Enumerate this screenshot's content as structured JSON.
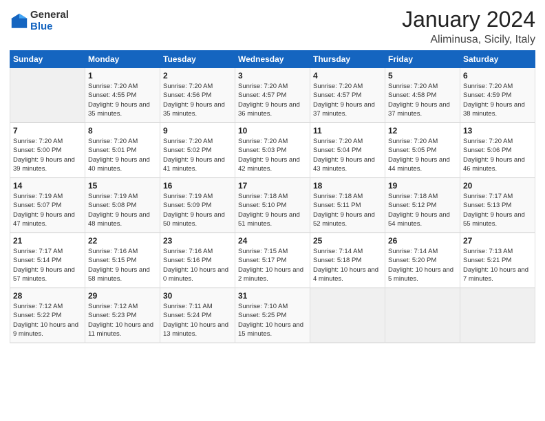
{
  "header": {
    "logo_general": "General",
    "logo_blue": "Blue",
    "title": "January 2024",
    "location": "Aliminusa, Sicily, Italy"
  },
  "weekdays": [
    "Sunday",
    "Monday",
    "Tuesday",
    "Wednesday",
    "Thursday",
    "Friday",
    "Saturday"
  ],
  "weeks": [
    [
      {
        "day": "",
        "sunrise": "",
        "sunset": "",
        "daylight": ""
      },
      {
        "day": "1",
        "sunrise": "Sunrise: 7:20 AM",
        "sunset": "Sunset: 4:55 PM",
        "daylight": "Daylight: 9 hours and 35 minutes."
      },
      {
        "day": "2",
        "sunrise": "Sunrise: 7:20 AM",
        "sunset": "Sunset: 4:56 PM",
        "daylight": "Daylight: 9 hours and 35 minutes."
      },
      {
        "day": "3",
        "sunrise": "Sunrise: 7:20 AM",
        "sunset": "Sunset: 4:57 PM",
        "daylight": "Daylight: 9 hours and 36 minutes."
      },
      {
        "day": "4",
        "sunrise": "Sunrise: 7:20 AM",
        "sunset": "Sunset: 4:57 PM",
        "daylight": "Daylight: 9 hours and 37 minutes."
      },
      {
        "day": "5",
        "sunrise": "Sunrise: 7:20 AM",
        "sunset": "Sunset: 4:58 PM",
        "daylight": "Daylight: 9 hours and 37 minutes."
      },
      {
        "day": "6",
        "sunrise": "Sunrise: 7:20 AM",
        "sunset": "Sunset: 4:59 PM",
        "daylight": "Daylight: 9 hours and 38 minutes."
      }
    ],
    [
      {
        "day": "7",
        "sunrise": "Sunrise: 7:20 AM",
        "sunset": "Sunset: 5:00 PM",
        "daylight": "Daylight: 9 hours and 39 minutes."
      },
      {
        "day": "8",
        "sunrise": "Sunrise: 7:20 AM",
        "sunset": "Sunset: 5:01 PM",
        "daylight": "Daylight: 9 hours and 40 minutes."
      },
      {
        "day": "9",
        "sunrise": "Sunrise: 7:20 AM",
        "sunset": "Sunset: 5:02 PM",
        "daylight": "Daylight: 9 hours and 41 minutes."
      },
      {
        "day": "10",
        "sunrise": "Sunrise: 7:20 AM",
        "sunset": "Sunset: 5:03 PM",
        "daylight": "Daylight: 9 hours and 42 minutes."
      },
      {
        "day": "11",
        "sunrise": "Sunrise: 7:20 AM",
        "sunset": "Sunset: 5:04 PM",
        "daylight": "Daylight: 9 hours and 43 minutes."
      },
      {
        "day": "12",
        "sunrise": "Sunrise: 7:20 AM",
        "sunset": "Sunset: 5:05 PM",
        "daylight": "Daylight: 9 hours and 44 minutes."
      },
      {
        "day": "13",
        "sunrise": "Sunrise: 7:20 AM",
        "sunset": "Sunset: 5:06 PM",
        "daylight": "Daylight: 9 hours and 46 minutes."
      }
    ],
    [
      {
        "day": "14",
        "sunrise": "Sunrise: 7:19 AM",
        "sunset": "Sunset: 5:07 PM",
        "daylight": "Daylight: 9 hours and 47 minutes."
      },
      {
        "day": "15",
        "sunrise": "Sunrise: 7:19 AM",
        "sunset": "Sunset: 5:08 PM",
        "daylight": "Daylight: 9 hours and 48 minutes."
      },
      {
        "day": "16",
        "sunrise": "Sunrise: 7:19 AM",
        "sunset": "Sunset: 5:09 PM",
        "daylight": "Daylight: 9 hours and 50 minutes."
      },
      {
        "day": "17",
        "sunrise": "Sunrise: 7:18 AM",
        "sunset": "Sunset: 5:10 PM",
        "daylight": "Daylight: 9 hours and 51 minutes."
      },
      {
        "day": "18",
        "sunrise": "Sunrise: 7:18 AM",
        "sunset": "Sunset: 5:11 PM",
        "daylight": "Daylight: 9 hours and 52 minutes."
      },
      {
        "day": "19",
        "sunrise": "Sunrise: 7:18 AM",
        "sunset": "Sunset: 5:12 PM",
        "daylight": "Daylight: 9 hours and 54 minutes."
      },
      {
        "day": "20",
        "sunrise": "Sunrise: 7:17 AM",
        "sunset": "Sunset: 5:13 PM",
        "daylight": "Daylight: 9 hours and 55 minutes."
      }
    ],
    [
      {
        "day": "21",
        "sunrise": "Sunrise: 7:17 AM",
        "sunset": "Sunset: 5:14 PM",
        "daylight": "Daylight: 9 hours and 57 minutes."
      },
      {
        "day": "22",
        "sunrise": "Sunrise: 7:16 AM",
        "sunset": "Sunset: 5:15 PM",
        "daylight": "Daylight: 9 hours and 58 minutes."
      },
      {
        "day": "23",
        "sunrise": "Sunrise: 7:16 AM",
        "sunset": "Sunset: 5:16 PM",
        "daylight": "Daylight: 10 hours and 0 minutes."
      },
      {
        "day": "24",
        "sunrise": "Sunrise: 7:15 AM",
        "sunset": "Sunset: 5:17 PM",
        "daylight": "Daylight: 10 hours and 2 minutes."
      },
      {
        "day": "25",
        "sunrise": "Sunrise: 7:14 AM",
        "sunset": "Sunset: 5:18 PM",
        "daylight": "Daylight: 10 hours and 4 minutes."
      },
      {
        "day": "26",
        "sunrise": "Sunrise: 7:14 AM",
        "sunset": "Sunset: 5:20 PM",
        "daylight": "Daylight: 10 hours and 5 minutes."
      },
      {
        "day": "27",
        "sunrise": "Sunrise: 7:13 AM",
        "sunset": "Sunset: 5:21 PM",
        "daylight": "Daylight: 10 hours and 7 minutes."
      }
    ],
    [
      {
        "day": "28",
        "sunrise": "Sunrise: 7:12 AM",
        "sunset": "Sunset: 5:22 PM",
        "daylight": "Daylight: 10 hours and 9 minutes."
      },
      {
        "day": "29",
        "sunrise": "Sunrise: 7:12 AM",
        "sunset": "Sunset: 5:23 PM",
        "daylight": "Daylight: 10 hours and 11 minutes."
      },
      {
        "day": "30",
        "sunrise": "Sunrise: 7:11 AM",
        "sunset": "Sunset: 5:24 PM",
        "daylight": "Daylight: 10 hours and 13 minutes."
      },
      {
        "day": "31",
        "sunrise": "Sunrise: 7:10 AM",
        "sunset": "Sunset: 5:25 PM",
        "daylight": "Daylight: 10 hours and 15 minutes."
      },
      {
        "day": "",
        "sunrise": "",
        "sunset": "",
        "daylight": ""
      },
      {
        "day": "",
        "sunrise": "",
        "sunset": "",
        "daylight": ""
      },
      {
        "day": "",
        "sunrise": "",
        "sunset": "",
        "daylight": ""
      }
    ]
  ]
}
